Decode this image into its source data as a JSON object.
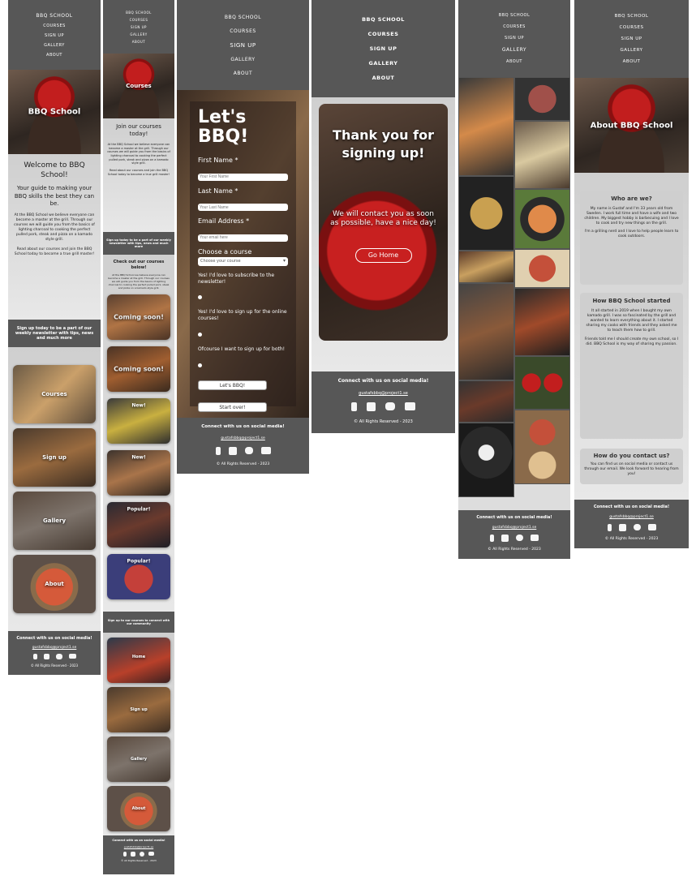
{
  "nav": {
    "items": [
      "BBQ SCHOOL",
      "COURSES",
      "SIGN UP",
      "GALLERY",
      "ABOUT"
    ]
  },
  "home": {
    "hero": "BBQ School",
    "welcome": "Welcome to BBQ School!",
    "lead": "Your guide to making your BBQ skills the best they can be.",
    "body1": "At the BBQ School we believe everyone can become a master at the grill. Through our courses we will guide you from the basics of lighting charcoal to cooking the perfect pulled pork, steak and pizza on a kamado style grill.",
    "body2": "Read about our courses and join the BBQ School today to become a true grill master!",
    "signup_band": "Sign up today to be a part of our weekly newsletter with tips, news and much more",
    "tiles": [
      "Courses",
      "Sign up",
      "Gallery",
      "About"
    ]
  },
  "courses": {
    "hero": "Courses",
    "join": "Join our courses today!",
    "band": "Sign up today to be a part of our weekly newsletter with tips, news and much more",
    "check": "Check out our courses below!",
    "tiles": [
      "Coming soon!",
      "Coming soon!",
      "New!",
      "New!",
      "Popular!",
      "Popular!"
    ],
    "band2": "Sign up to our courses to connect with our community",
    "links": [
      "Home",
      "Sign up",
      "Gallery",
      "About"
    ]
  },
  "signup": {
    "title": "Let's BBQ!",
    "first": "First Name *",
    "first_ph": "Your First Name",
    "last": "Last Name *",
    "last_ph": "Your Last Name",
    "email": "Email Address *",
    "email_ph": "Your email here",
    "course": "Choose a course",
    "course_sel": "Choose your course",
    "opt1": "Yes! I'd love to subscribe to the newsletter!",
    "opt2": "Yes! I'd love to sign up for the online courses!",
    "opt3": "Ofcourse I want to sign up for both!",
    "submit": "Let's BBQ!",
    "reset": "Start over!"
  },
  "thanks": {
    "title": "Thank you for signing up!",
    "msg": "We will contact you as soon as possible, have a nice day!",
    "btn": "Go Home"
  },
  "about": {
    "hero": "About BBQ School",
    "who_h": "Who are we?",
    "who_b": "My name is Gustaf and I'm 33 years old from Sweden. I work full time and have a wife and two children. My biggest hobby is barbecuing and I love to cook and try new things on the grill.",
    "who_b2": "I'm a grilling nerd and I love to help people learn to cook outdoors.",
    "how_h": "How BBQ School started",
    "how_b": "It all started in 2019 when I bought my own kamado grill. I was so fascinated by the grill and wanted to learn everything about it. I started sharing my cooks with friends and they asked me to teach them how to grill.",
    "how_b2": "Friends told me I should create my own school, so I did. BBQ School is my way of sharing my passion.",
    "contact_h": "How do you contact us?",
    "contact_b": "You can find us on social media or contact us through our email. We look forward to hearing from you!"
  },
  "footer": {
    "title": "Connect with us on social media!",
    "email": "gustafsbbq@project1.se",
    "copy": "© All Rights Reserved - 2023"
  }
}
